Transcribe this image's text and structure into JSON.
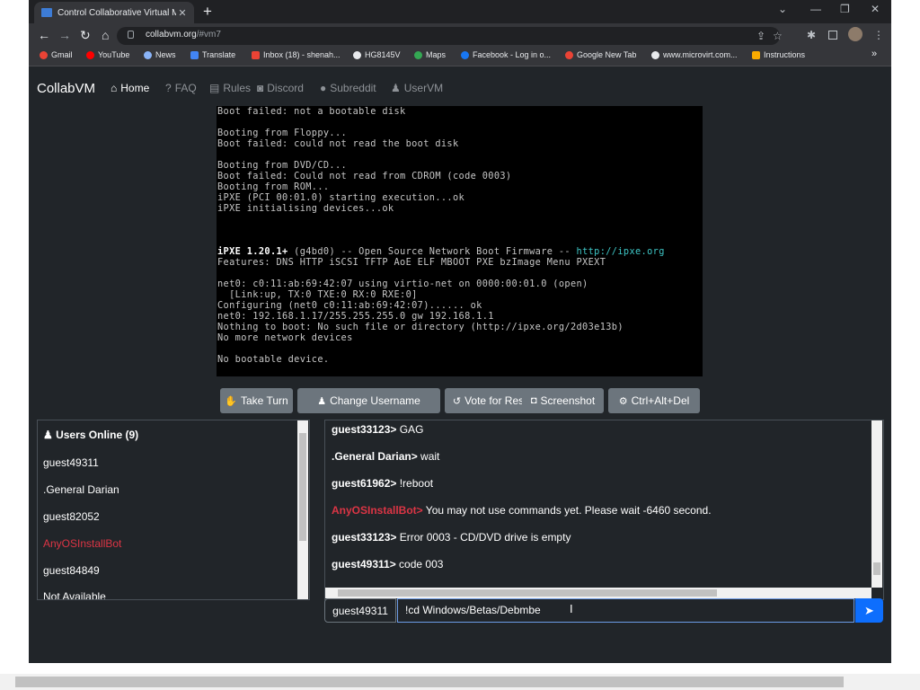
{
  "browser": {
    "tab_title": "Control Collaborative Virtual Ma",
    "url_host": "collabvm.org",
    "url_path": "/#vm7",
    "bookmarks": [
      {
        "label": "Gmail",
        "color": "#ea4335"
      },
      {
        "label": "YouTube",
        "color": "#ff0000"
      },
      {
        "label": "News",
        "color": "#8ab4f8"
      },
      {
        "label": "Translate",
        "color": "#4285f4"
      },
      {
        "label": "Inbox (18) - shenah...",
        "color": "#ea4335"
      },
      {
        "label": "HG8145V",
        "color": "#e8eaed"
      },
      {
        "label": "Maps",
        "color": "#34a853"
      },
      {
        "label": "Facebook - Log in o...",
        "color": "#1877f2"
      },
      {
        "label": "Google New Tab",
        "color": "#ea4335"
      },
      {
        "label": "www.microvirt.com...",
        "color": "#e8eaed"
      },
      {
        "label": "Instructions",
        "color": "#f9ab00"
      }
    ]
  },
  "nav": {
    "brand": "CollabVM",
    "links": [
      {
        "label": "Home",
        "icon": "home-icon",
        "active": true
      },
      {
        "label": "FAQ",
        "icon": "question-icon"
      },
      {
        "label": "Rules",
        "icon": "clipboard-icon"
      },
      {
        "label": "Discord",
        "icon": "discord-icon"
      },
      {
        "label": "Subreddit",
        "icon": "reddit-icon"
      },
      {
        "label": "UserVM",
        "icon": "person-icon"
      }
    ]
  },
  "vm_screen": {
    "lines": [
      "Boot failed: not a bootable disk",
      "",
      "Booting from Floppy...",
      "Boot failed: could not read the boot disk",
      "",
      "Booting from DVD/CD...",
      "Boot failed: Could not read from CDROM (code 0003)",
      "Booting from ROM...",
      "iPXE (PCI 00:01.0) starting execution...ok",
      "iPXE initialising devices...ok",
      "",
      "",
      "",
      "iPXE 1.20.1+ (g4bd0) -- Open Source Network Boot Firmware -- http://ipxe.org",
      "Features: DNS HTTP iSCSI TFTP AoE ELF MBOOT PXE bzImage Menu PXEXT",
      "",
      "net0: c0:11:ab:69:42:07 using virtio-net on 0000:00:01.0 (open)",
      "  [Link:up, TX:0 TXE:0 RX:0 RXE:0]",
      "Configuring (net0 c0:11:ab:69:42:07)...... ok",
      "net0: 192.168.1.17/255.255.255.0 gw 192.168.1.1",
      "Nothing to boot: No such file or directory (http://ipxe.org/2d03e13b)",
      "No more network devices",
      "",
      "No bootable device."
    ]
  },
  "vm_buttons": [
    {
      "label": "Take Turn",
      "icon": "hand-icon"
    },
    {
      "label": "Change Username",
      "icon": "person-gear-icon"
    },
    {
      "label": "Vote for Reset",
      "icon": "reset-icon"
    },
    {
      "label": "Screenshot",
      "icon": "camera-icon"
    },
    {
      "label": "Ctrl+Alt+Del",
      "icon": "gear-icon"
    }
  ],
  "users": {
    "header": "Users Online (9)",
    "list": [
      {
        "name": "guest49311"
      },
      {
        "name": ".General Darian"
      },
      {
        "name": "guest82052"
      },
      {
        "name": "AnyOSInstallBot",
        "bot": true
      },
      {
        "name": "guest84849"
      },
      {
        "name": "Not Available"
      }
    ]
  },
  "chat": {
    "messages": [
      {
        "nick": "guest33123>",
        "text": " GAG"
      },
      {
        "nick": ".General Darian>",
        "text": " wait"
      },
      {
        "nick": "guest61962>",
        "text": " !reboot"
      },
      {
        "nick": "AnyOSInstallBot>",
        "text": " You may not use commands yet. Please wait -6460 second.",
        "bot": true
      },
      {
        "nick": "guest33123>",
        "text": " Error 0003 - CD/DVD drive is empty"
      },
      {
        "nick": "guest49311>",
        "text": " code 003"
      }
    ],
    "username": "guest49311",
    "input_value": "!cd Windows/Betas/Debmbe"
  }
}
